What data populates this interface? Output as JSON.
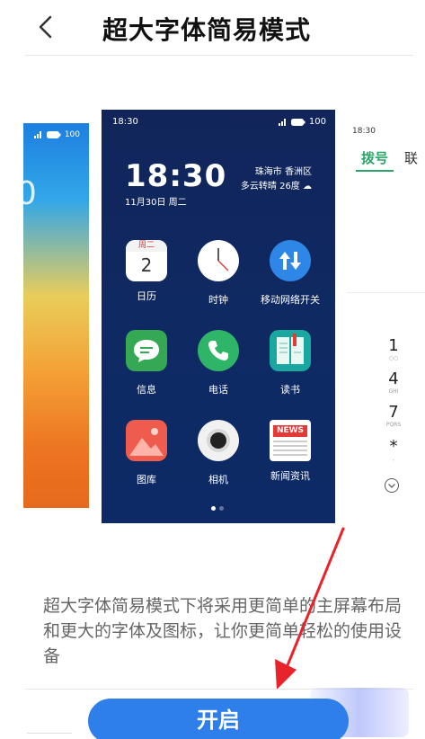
{
  "header": {
    "title": "超大字体简易模式"
  },
  "left_preview": {
    "status_battery": "100",
    "big_digit": "0"
  },
  "center_preview": {
    "status_time": "18:30",
    "status_battery": "100",
    "clock": "18:30",
    "date": "11月30日 周二",
    "location": "珠海市 香洲区",
    "weather": "多云转晴 26度",
    "apps": [
      {
        "label": "日历",
        "icon": "calendar-icon",
        "cal_day": "周二",
        "cal_num": "2"
      },
      {
        "label": "时钟",
        "icon": "clock-icon"
      },
      {
        "label": "移动网络开关",
        "icon": "mobile-data-icon"
      },
      {
        "label": "信息",
        "icon": "message-icon"
      },
      {
        "label": "电话",
        "icon": "phone-icon"
      },
      {
        "label": "读书",
        "icon": "book-icon"
      },
      {
        "label": "图库",
        "icon": "gallery-icon"
      },
      {
        "label": "相机",
        "icon": "camera-icon"
      },
      {
        "label": "新闻资讯",
        "icon": "news-icon",
        "badge": "NEWS"
      }
    ]
  },
  "right_preview": {
    "status_time": "18:30",
    "tab_dial": "拨号",
    "tab_other": "联",
    "keys": [
      {
        "num": "1",
        "sub": ""
      },
      {
        "num": "4",
        "sub": "GHI"
      },
      {
        "num": "7",
        "sub": "PQRS"
      },
      {
        "num": "*",
        "sub": ","
      }
    ]
  },
  "description": "超大字体简易模式下将采用更简单的主屏幕布局和更大的字体及图标，让你更简单轻松的使用设备",
  "enable_button": "开启",
  "colors": {
    "accent": "#2f7fea",
    "dial_green": "#2aa56a",
    "arrow_red": "#e8232a"
  }
}
